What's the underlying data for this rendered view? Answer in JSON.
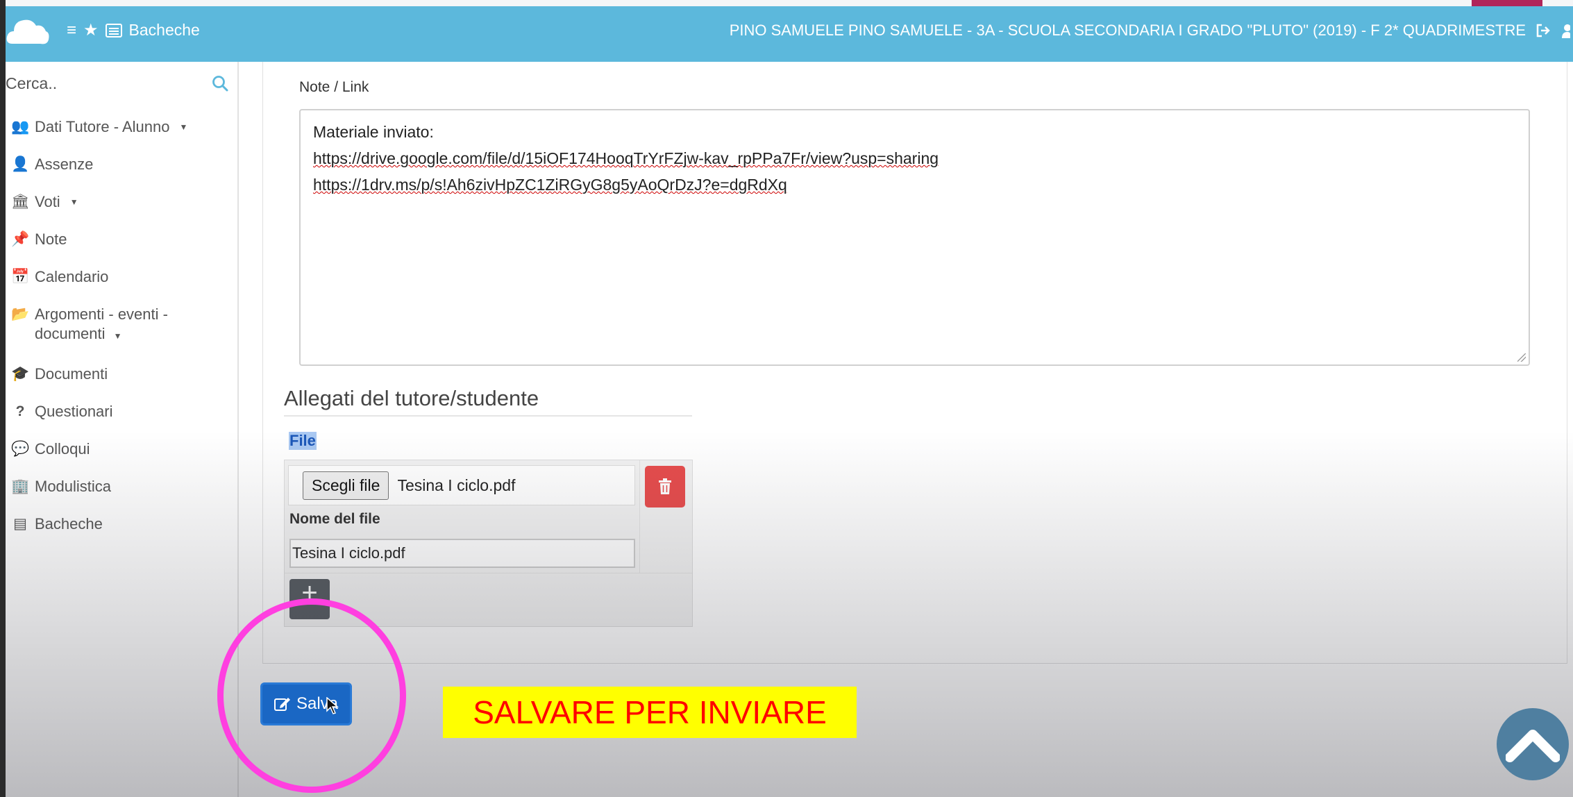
{
  "header": {
    "nav_label": "Bacheche",
    "user_info": "PINO SAMUELE  PINO SAMUELE - 3A - SCUOLA SECONDARIA I GRADO \"PLUTO\" (2019) - F  2* QUADRIMESTRE"
  },
  "sidebar": {
    "search_placeholder": "Cerca..",
    "items": [
      {
        "label": "Dati Tutore - Alunno",
        "icon": "users-icon",
        "caret": true
      },
      {
        "label": "Assenze",
        "icon": "user-icon",
        "caret": false
      },
      {
        "label": "Voti",
        "icon": "bank-icon",
        "caret": true
      },
      {
        "label": "Note",
        "icon": "pushpin-icon",
        "caret": false
      },
      {
        "label": "Calendario",
        "icon": "calendar-icon",
        "caret": false
      },
      {
        "label": "Argomenti - eventi -",
        "label2": "documenti",
        "icon": "folder-open-icon",
        "caret": true
      },
      {
        "label": "Documenti",
        "icon": "graduation-cap-icon",
        "caret": false
      },
      {
        "label": "Questionari",
        "icon": "question-icon",
        "caret": false
      },
      {
        "label": "Colloqui",
        "icon": "comments-icon",
        "caret": false
      },
      {
        "label": "Modulistica",
        "icon": "building-icon",
        "caret": false
      },
      {
        "label": "Bacheche",
        "icon": "list-alt-icon",
        "caret": false
      }
    ]
  },
  "note": {
    "label": "Note / Link",
    "line1": "Materiale inviato:",
    "line2": "https://drive.google.com/file/d/15iOF174HooqTrYrFZjw-kav_rpPPa7Fr/view?usp=sharing",
    "line3": "https://1drv.ms/p/s!Ah6zivHpZC1ZiRGyG8g5yAoQrDzJ?e=dgRdXq"
  },
  "attachments": {
    "title": "Allegati del tutore/studente",
    "file_label": "File",
    "choose_button": "Scegli file",
    "chosen_file": "Tesina I ciclo.pdf",
    "filename_label": "Nome del file",
    "filename_value": "Tesina I ciclo.pdf",
    "add_label": "+"
  },
  "save_button": "Salva",
  "callout_text": "SALVARE PER INVIARE",
  "colors": {
    "header": "#5cb8dc",
    "save": "#1a67c4",
    "delete": "#e74c4c",
    "highlight": "#ff3fe0",
    "callout_bg": "#ffff00",
    "callout_text": "#ff0000"
  }
}
